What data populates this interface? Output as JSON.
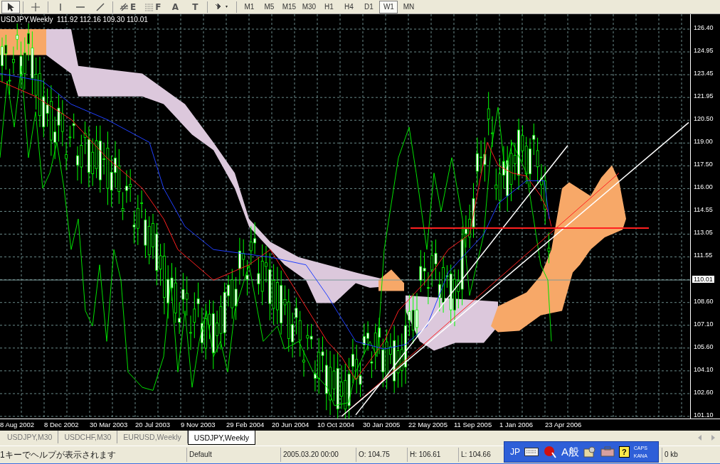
{
  "toolbar": {
    "tools": [
      {
        "kind": "cursor",
        "selected": true
      },
      {
        "kind": "crosshair",
        "selected": false
      },
      {
        "kind": "vline",
        "selected": false
      },
      {
        "kind": "hline",
        "selected": false
      },
      {
        "kind": "trendline",
        "selected": false
      },
      {
        "kind": "channel",
        "glyph": "E",
        "selected": false
      },
      {
        "kind": "fibo",
        "glyph": "F",
        "selected": false
      },
      {
        "kind": "text",
        "glyph": "A",
        "selected": false
      },
      {
        "kind": "label",
        "glyph": "T",
        "selected": false
      },
      {
        "kind": "arrows",
        "selected": false
      }
    ],
    "timeframes": [
      {
        "label": "M1",
        "selected": false
      },
      {
        "label": "M5",
        "selected": false
      },
      {
        "label": "M15",
        "selected": false
      },
      {
        "label": "M30",
        "selected": false
      },
      {
        "label": "H1",
        "selected": false
      },
      {
        "label": "H4",
        "selected": false
      },
      {
        "label": "D1",
        "selected": false
      },
      {
        "label": "W1",
        "selected": true
      },
      {
        "label": "MN",
        "selected": false
      }
    ]
  },
  "chart": {
    "symbol": "USDJPY,Weekly",
    "ohlc": "111.92 112.16 109.30 110.01",
    "current_price": "110.01",
    "price_ticks": [
      "126.40",
      "124.95",
      "123.45",
      "121.95",
      "120.50",
      "119.00",
      "117.50",
      "116.00",
      "114.55",
      "113.05",
      "111.55",
      "108.60",
      "107.10",
      "105.60",
      "104.10",
      "102.60",
      "101.10"
    ],
    "date_ticks": [
      "8 Aug 2002",
      "8 Dec 2002",
      "30 Mar 2003",
      "20 Jul 2003",
      "9 Nov 2003",
      "29 Feb 2004",
      "20 Jun 2004",
      "10 Oct 2004",
      "30 Jan 2005",
      "22 May 2005",
      "11 Sep 2005",
      "1 Jan 2006",
      "23 Apr 2006"
    ]
  },
  "tabs": [
    {
      "label": "USDJPY,M30",
      "selected": false
    },
    {
      "label": "USDCHF,M30",
      "selected": false
    },
    {
      "label": "EURUSD,Weekly",
      "selected": false
    },
    {
      "label": "USDJPY,Weekly",
      "selected": true
    }
  ],
  "status_bar": {
    "help": "1キーでヘルプが表示されます",
    "profile": "Default",
    "time": "2005.03.20 00:00",
    "open": "O: 104.75",
    "high": "H: 106.61",
    "low": "L: 104.66",
    "traffic": "0 kb"
  },
  "language_bar": {
    "language": "JP",
    "input_mode": "A般",
    "caps": "CAPS",
    "kana": "KANA",
    "help_glyph": "?"
  }
}
